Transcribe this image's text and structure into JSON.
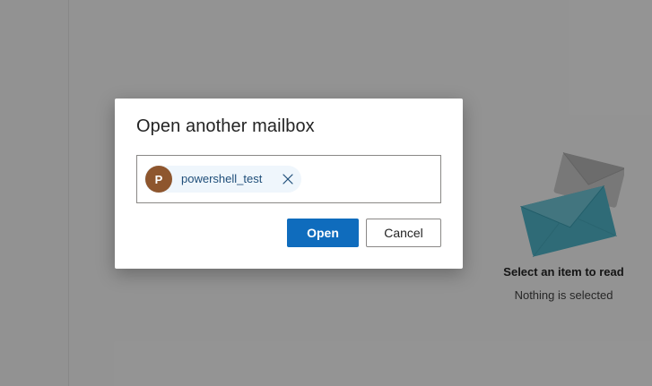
{
  "reading_pane": {
    "empty_title": "Select an item to read",
    "empty_subtitle": "Nothing is selected"
  },
  "dialog": {
    "title": "Open another mailbox",
    "picker": {
      "chip": {
        "initial": "P",
        "label": "powershell_test",
        "avatar_color": "#8e562e"
      }
    },
    "buttons": {
      "open_label": "Open",
      "cancel_label": "Cancel"
    }
  },
  "colors": {
    "primary": "#0f6cbd",
    "overlay": "rgba(0,0,0,0.40)"
  },
  "icons": {
    "chip_remove": "close-icon",
    "illustration": "envelopes-illustration"
  }
}
